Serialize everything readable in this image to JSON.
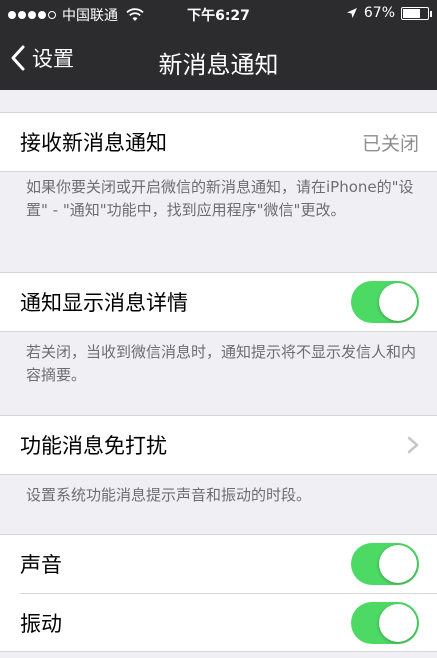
{
  "status": {
    "carrier": "中国联通",
    "time": "下午6:27",
    "battery": "67%"
  },
  "nav": {
    "back_label": "设置",
    "title": "新消息通知"
  },
  "sections": {
    "receive": {
      "label": "接收新消息通知",
      "value": "已关闭",
      "footer": "如果你要关闭或开启微信的新消息通知，请在iPhone的\"设置\" - \"通知\"功能中，找到应用程序\"微信\"更改。"
    },
    "details": {
      "label": "通知显示消息详情",
      "on": true,
      "footer": "若关闭，当收到微信消息时，通知提示将不显示发信人和内容摘要。"
    },
    "dnd": {
      "label": "功能消息免打扰",
      "footer": "设置系统功能消息提示声音和振动的时段。"
    },
    "alerts": {
      "sound_label": "声音",
      "sound_on": true,
      "vibrate_label": "振动",
      "vibrate_on": true
    }
  },
  "colors": {
    "switch_on": "#4cd964",
    "bar": "#2c2c2e",
    "background": "#efeff4"
  }
}
